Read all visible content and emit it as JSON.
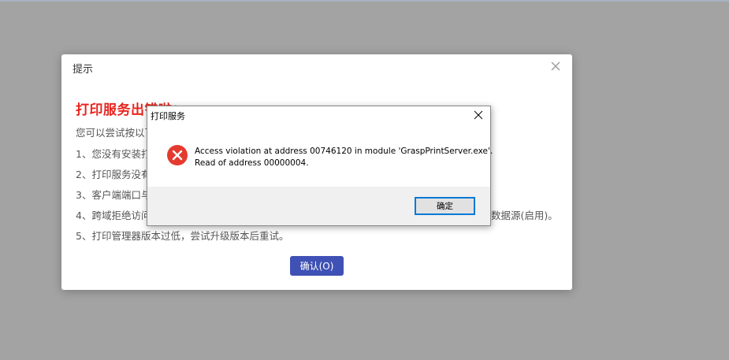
{
  "dialog": {
    "title": "提示",
    "heading": "打印服务出错啦：",
    "hint": "您可以尝试按以下",
    "reasons": [
      "1、您没有安装打",
      "2、打印服务没有",
      "3、客户端端口与",
      "4、跨域拒绝访问",
      "5、打印管理器版本过低，尝试升级版本后重试。"
    ],
    "reason4_tail": "数据源(启用)。",
    "confirm_label": "确认(O)",
    "close_icon": "close-icon",
    "accent_color": "#3f51b5",
    "heading_color": "#e8251f"
  },
  "msgbox": {
    "title": "打印服务",
    "message_line1": "Access violation at address 00746120 in module 'GraspPrintServer.exe'.",
    "message_line2": "Read of address 00000004.",
    "ok_label": "确定",
    "icon": "error-icon",
    "icon_color": "#e53a2f"
  }
}
